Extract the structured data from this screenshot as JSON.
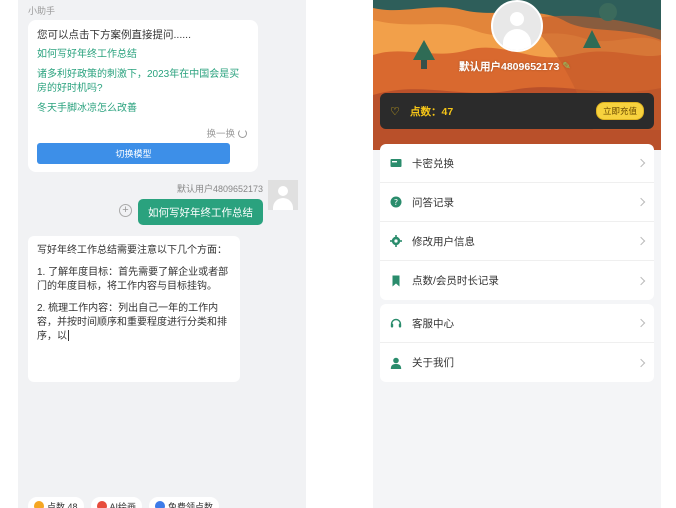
{
  "chat": {
    "assistant_name": "小助手",
    "suggest_intro": "您可以点击下方案例直接提问......",
    "suggestions": [
      "如何写好年终工作总结",
      "诸多利好政策的刺激下，2023年在中国会是买房的好时机吗?",
      "冬天手脚冰凉怎么改善"
    ],
    "refresh_label": "换一换",
    "switch_model_label": "切换模型",
    "user_name": "默认用户4809652173",
    "user_message": "如何写好年终工作总结",
    "answer": {
      "intro": "写好年终工作总结需要注意以下几个方面：",
      "point1": "1. 了解年度目标：首先需要了解企业或者部门的年度目标，将工作内容与目标挂钩。",
      "point2": "2. 梳理工作内容：列出自己一年的工作内容，并按时间顺序和重要程度进行分类和排序，以"
    },
    "chips": [
      {
        "label": "点数 48",
        "color": "#f5a623"
      },
      {
        "label": "AI绘画",
        "color": "#e74c3c"
      },
      {
        "label": "免费领点数",
        "color": "#3d7be8"
      }
    ]
  },
  "profile": {
    "user_name": "默认用户4809652173",
    "points_label": "点数：47",
    "recharge_label": "立即充值",
    "menu_group_1": [
      {
        "label": "卡密兑换",
        "icon": "card-icon"
      },
      {
        "label": "问答记录",
        "icon": "question-icon"
      },
      {
        "label": "修改用户信息",
        "icon": "gear-icon"
      },
      {
        "label": "点数/会员时长记录",
        "icon": "bookmark-icon"
      }
    ],
    "menu_group_2": [
      {
        "label": "客服中心",
        "icon": "headset-icon"
      },
      {
        "label": "关于我们",
        "icon": "person-icon"
      }
    ],
    "accent_color": "#2aa27e",
    "icon_color": "#2a8c6c"
  }
}
